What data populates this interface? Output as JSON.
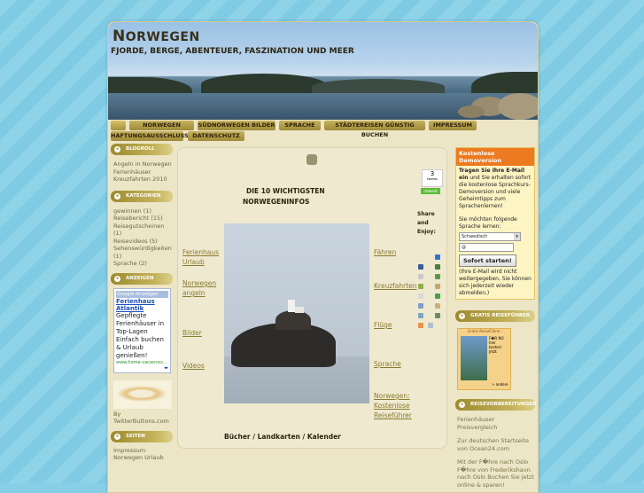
{
  "site": {
    "title_cap": "N",
    "title_rest": "ORWEGEN",
    "tagline": "FJORDE, BERGE, ABENTEUER, FASZINATION UND MEER"
  },
  "nav": {
    "row1": [
      "NORWEGEN URLAUB",
      "SÜDNORWEGEN BILDER",
      "SPRACHE",
      "STÄDTEREISEN GÜNSTIG BUCHEN",
      "IMPRESSUM"
    ],
    "row2": [
      "HAFTUNGSAUSSCHLUSS",
      "DATENSCHUTZ"
    ]
  },
  "left": {
    "blogroll": {
      "title": "BLOGROLL",
      "links": [
        "Angeln in Norwegen",
        "Ferienhäuser Kreuzfahrten 2010"
      ]
    },
    "categories": {
      "title": "KATEGORIEN",
      "items": [
        "gewinnen (1)",
        "Reisebericht (15)",
        "Reisegutscheinen (1)",
        "Reisevideos (5)",
        "Sehenswürdigkeiten (1)",
        "Sprache (2)"
      ]
    },
    "ads": {
      "title": "ANZEIGEN",
      "google": "Google-Anzeigen",
      "ad_title": "Ferienhaus Atlantik",
      "ad_text": "Gepflegte Ferienhäuser in Top-Lagen Einfach buchen & Urlaub genießen!",
      "ad_url": "www.home-vacances..."
    },
    "twitter": "By TwitterButtons.com",
    "pages": {
      "title": "SEITEN",
      "links": [
        "Impressum",
        "Norwegen Urlaub"
      ]
    }
  },
  "main": {
    "heading_line1": "DIE 10 WICHTIGSTEN",
    "heading_line2": "NORWEGENINFOS",
    "tweets_count": "3",
    "tweets_label": "tweets",
    "retweet": "retweet",
    "share": "Share and Enjoy:",
    "left_links": [
      "Ferienhaus Urlaub",
      "Norwegen angeln",
      "Bilder",
      "Videos"
    ],
    "right_links": [
      "Fähren",
      "Kreuzfahrten",
      "Flüge",
      "Sprache",
      "Norwegen: Kostenlose Reiseführer"
    ],
    "bottom": "Bücher / Landkarten / Kalender"
  },
  "right": {
    "promo": {
      "head": "Kostenlose Demoversion",
      "bold": "Tragen Sie Ihre E-Mail ein",
      "text": "und Sie erhalten sofort die kostenlose Sprachkurs-Demoversion und viele Geheimtipps zum Sprachenlernen!",
      "ask": "Sie möchten folgende Sprache lernen:",
      "select_value": "Schwedisch",
      "email_value": "@",
      "button": "Sofort starten!",
      "note": "(Ihre E-Mail wird nicht weitergegeben, Sie können sich jederzeit wieder abmelden.)"
    },
    "guides": {
      "title": "GRATIS REISEFÜHRER",
      "book_title": "Gratis-ReiseFührer",
      "book_text": "F�R NO hier kosten! Jetzt",
      "book_more": "> andere"
    },
    "prep": {
      "title": "REISEVORBEREITUNGEN",
      "links": [
        "Ferienhäuser Preisvergleich",
        "Zur deutschen Startseite von Ocean24.com",
        "Mit der F�hre nach Oslo F�hre von Frederikshavn nach Oslo Buchen Sie jetzt online & sparen!"
      ]
    }
  },
  "colors": {
    "background": "#86cfe6",
    "frame": "#ece5c6",
    "nav": "#b29e4a",
    "accent": "#ec7a20"
  }
}
